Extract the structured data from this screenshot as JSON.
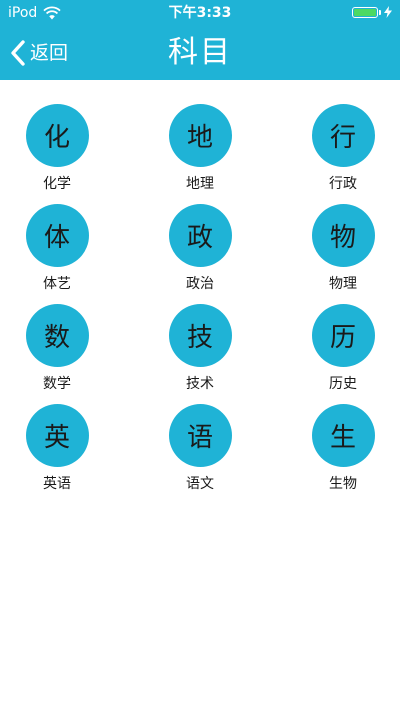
{
  "status_bar": {
    "carrier": "iPod",
    "time": "下午3:33",
    "battery_color": "#4cd964"
  },
  "nav": {
    "back_label": "返回",
    "title": "科目"
  },
  "theme": {
    "accent": "#1fb3d6"
  },
  "subjects": [
    {
      "char": "化",
      "label": "化学"
    },
    {
      "char": "地",
      "label": "地理"
    },
    {
      "char": "行",
      "label": "行政"
    },
    {
      "char": "体",
      "label": "体艺"
    },
    {
      "char": "政",
      "label": "政治"
    },
    {
      "char": "物",
      "label": "物理"
    },
    {
      "char": "数",
      "label": "数学"
    },
    {
      "char": "技",
      "label": "技术"
    },
    {
      "char": "历",
      "label": "历史"
    },
    {
      "char": "英",
      "label": "英语"
    },
    {
      "char": "语",
      "label": "语文"
    },
    {
      "char": "生",
      "label": "生物"
    }
  ]
}
